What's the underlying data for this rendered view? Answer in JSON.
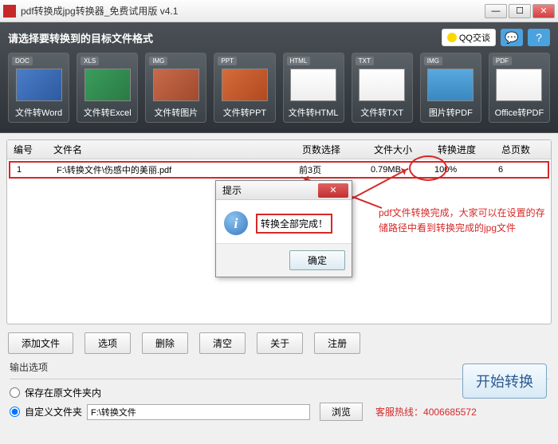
{
  "window": {
    "title": "pdf转换成jpg转换器_免费试用版 v4.1"
  },
  "header": {
    "title": "请选择要转换到的目标文件格式",
    "qq_label": "QQ交谈"
  },
  "formats": [
    {
      "tag": "DOC",
      "label": "文件转Word"
    },
    {
      "tag": "XLS",
      "label": "文件转Excel"
    },
    {
      "tag": "IMG",
      "label": "文件转图片"
    },
    {
      "tag": "PPT",
      "label": "文件转PPT"
    },
    {
      "tag": "HTML",
      "label": "文件转HTML"
    },
    {
      "tag": "TXT",
      "label": "文件转TXT"
    },
    {
      "tag": "IMG",
      "label": "图片转PDF"
    },
    {
      "tag": "PDF",
      "label": "Office转PDF"
    }
  ],
  "table": {
    "headers": {
      "id": "编号",
      "name": "文件名",
      "page": "页数选择",
      "size": "文件大小",
      "prog": "转换进度",
      "total": "总页数"
    },
    "rows": [
      {
        "id": "1",
        "name": "F:\\转换文件\\伤感中的美丽.pdf",
        "page": "前3页",
        "size": "0.79MB",
        "prog": "100%",
        "total": "6"
      }
    ]
  },
  "dialog": {
    "title": "提示",
    "message": "转换全部完成！",
    "ok": "确定"
  },
  "annotation": "pdf文件转换完成，大家可以在设置的存储路径中看到转换完成的jpg文件",
  "buttons": {
    "add": "添加文件",
    "opt": "选项",
    "del": "删除",
    "clear": "清空",
    "about": "关于",
    "reg": "注册"
  },
  "output": {
    "title": "输出选项",
    "save_orig": "保存在原文件夹内",
    "custom": "自定义文件夹",
    "path": "F:\\转换文件",
    "browse": "浏览",
    "hotline": "客服热线：4006685572"
  },
  "start": "开始转换"
}
